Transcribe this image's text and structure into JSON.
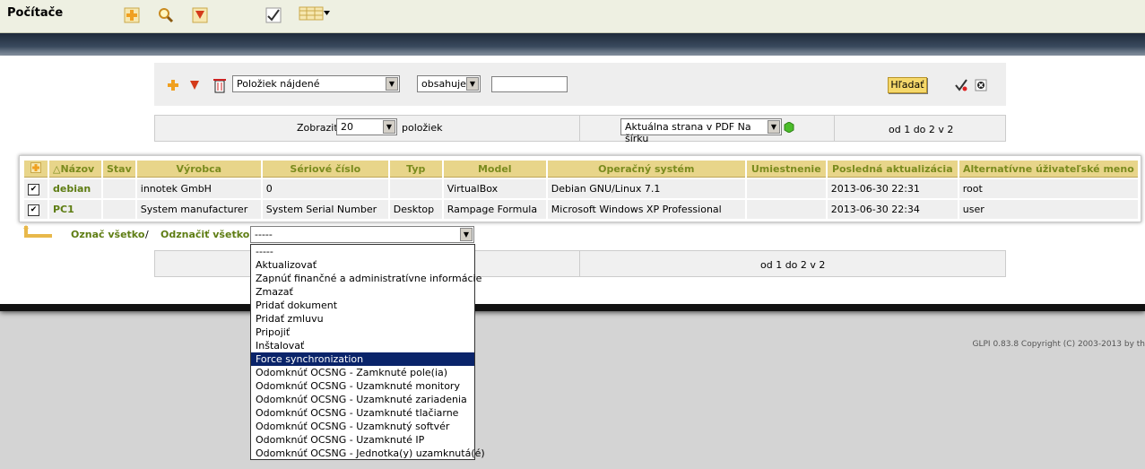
{
  "header": {
    "title": "Počítače"
  },
  "search": {
    "field_value": "Položiek nájdené",
    "operator_value": "obsahuje",
    "query_value": "",
    "search_button": "Hľadať"
  },
  "pager_top": {
    "show_label": "Zobraziť",
    "per_page": "20",
    "items_label": "položiek",
    "export_value": "Aktuálna strana v PDF Na šírku",
    "range": "od 1 do 2 v 2"
  },
  "table": {
    "headers": [
      "Názov",
      "Stav",
      "Výrobca",
      "Sériové číslo",
      "Typ",
      "Model",
      "Operačný systém",
      "Umiestnenie",
      "Posledná aktualizácia",
      "Alternatívne úživateľské meno"
    ],
    "rows": [
      [
        "debian",
        "",
        "innotek GmbH",
        "0",
        "",
        "VirtualBox",
        "Debian GNU/Linux 7.1",
        "",
        "2013-06-30 22:31",
        "root"
      ],
      [
        "PC1",
        "",
        "System manufacturer",
        "System Serial Number",
        "Desktop",
        "Rampage Formula",
        "Microsoft Windows XP Professional",
        "",
        "2013-06-30 22:34",
        "user"
      ]
    ]
  },
  "actions": {
    "mark_all": "Označ všetko",
    "separator": "/",
    "unmark_all": "Odznačiť všetko",
    "selected": "-----",
    "options": [
      "-----",
      "Aktualizovať",
      "Zapnúť finančné a administratívne informácie",
      "Zmazať",
      "Pridať dokument",
      "Pridať zmluvu",
      "Pripojiť",
      "Inštalovať",
      "Force synchronization",
      "Odomknúť OCSNG - Zamknuté pole(ia)",
      "Odomknúť OCSNG - Uzamknuté monitory",
      "Odomknúť OCSNG - Uzamknuté zariadenia",
      "Odomknúť OCSNG - Uzamknuté tlačiarne",
      "Odomknúť OCSNG - Uzamknutý softvér",
      "Odomknúť OCSNG - Uzamknuté IP",
      "Odomknúť OCSNG - Jednotka(y) uzamknutá(é)"
    ],
    "highlighted": "Force synchronization"
  },
  "pager_bottom": {
    "range": "od 1 do 2 v 2"
  },
  "footer": {
    "text": "GLPI 0.83.8 Copyright (C) 2003-2013 by th"
  }
}
